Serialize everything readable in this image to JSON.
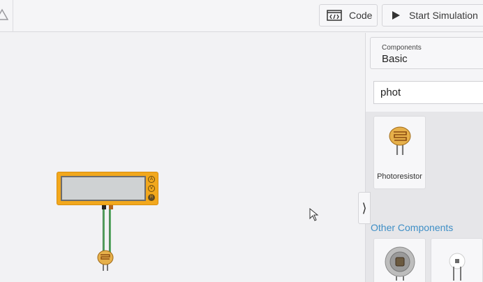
{
  "toolbar": {
    "code_label": "Code",
    "start_label": "Start Simulation"
  },
  "canvas": {
    "multimeter": {
      "ports": [
        "A",
        "V",
        "R"
      ]
    }
  },
  "panel": {
    "components_dropdown": {
      "label": "Components",
      "value": "Basic"
    },
    "search": {
      "value": "phot"
    },
    "results": [
      {
        "label": "Photoresistor",
        "icon": "photoresistor-icon"
      }
    ],
    "other_heading": "Other Components",
    "other_items": [
      {
        "icon": "ambient-light-sensor-icon"
      },
      {
        "icon": "phototransistor-icon"
      }
    ]
  },
  "colors": {
    "multimeter": "#f2a81d",
    "wire": "#5aa565",
    "link": "#3f8fc6",
    "photoresistor": "#e6b04a"
  }
}
